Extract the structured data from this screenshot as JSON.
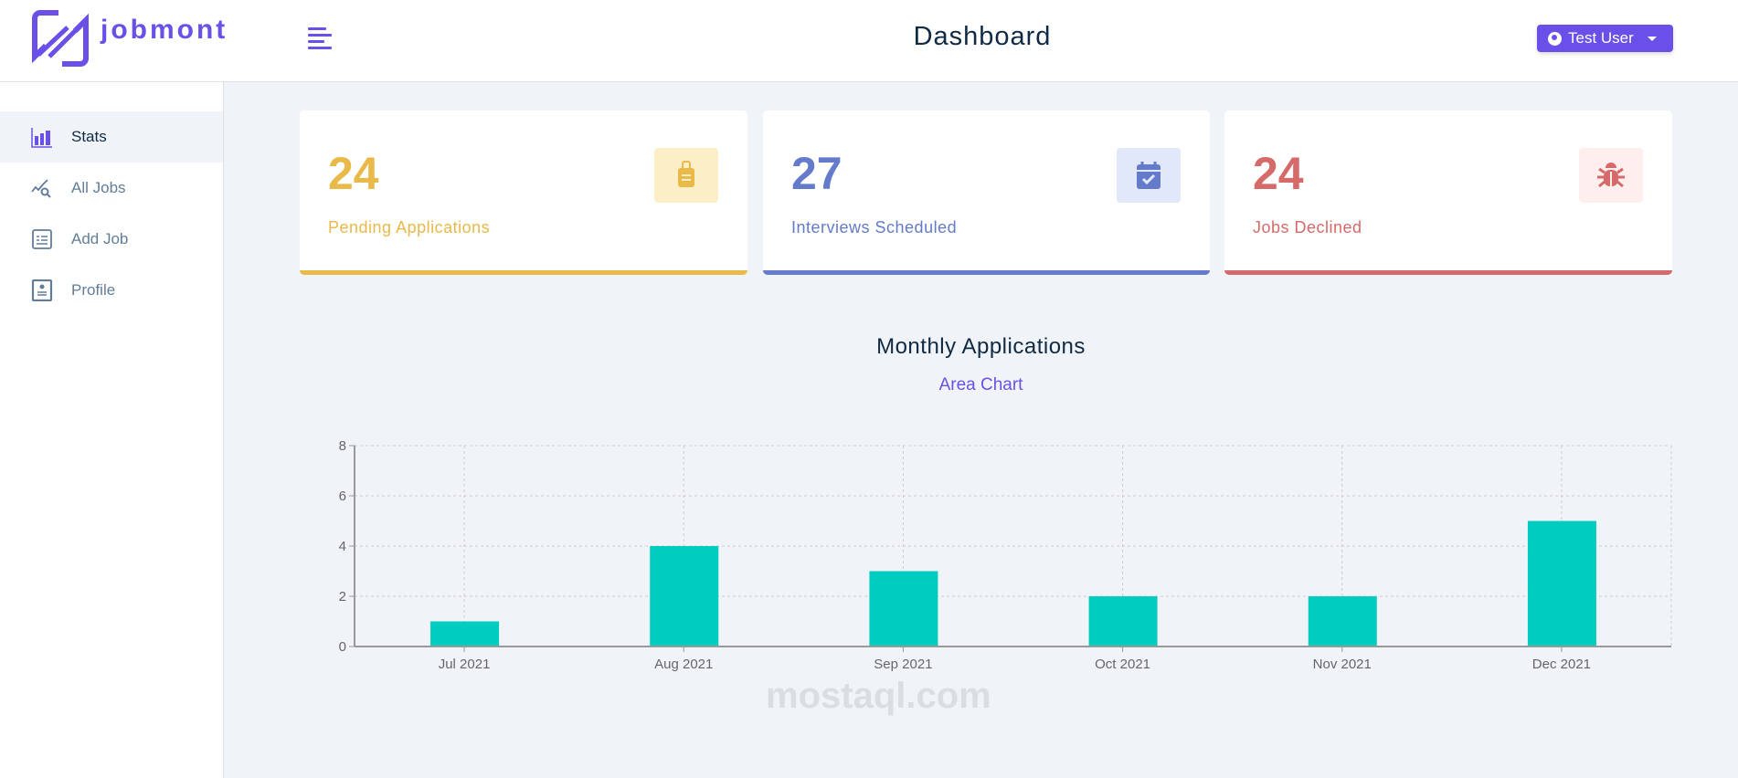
{
  "header": {
    "brand": "jobmont",
    "title": "Dashboard",
    "user": "Test User"
  },
  "sidebar": {
    "items": [
      {
        "label": "Stats",
        "icon": "bar-chart-icon"
      },
      {
        "label": "All Jobs",
        "icon": "chart-search-icon"
      },
      {
        "label": "Add Job",
        "icon": "form-icon"
      },
      {
        "label": "Profile",
        "icon": "profile-icon"
      }
    ]
  },
  "stats": [
    {
      "value": "24",
      "label": "Pending Applications",
      "color": "#e9b949",
      "bg": "#fcefc7",
      "icon": "suitcase-icon"
    },
    {
      "value": "27",
      "label": "Interviews Scheduled",
      "color": "#647acb",
      "bg": "#e0e8f9",
      "icon": "calendar-check-icon"
    },
    {
      "value": "24",
      "label": "Jobs Declined",
      "color": "#d66a6a",
      "bg": "#ffeeee",
      "icon": "bug-icon"
    }
  ],
  "chart_section": {
    "title": "Monthly Applications",
    "toggle": "Area Chart"
  },
  "chart_data": {
    "type": "bar",
    "categories": [
      "Jul 2021",
      "Aug 2021",
      "Sep 2021",
      "Oct 2021",
      "Nov 2021",
      "Dec 2021"
    ],
    "values": [
      1,
      4,
      3,
      2,
      2,
      5
    ],
    "ylim": [
      0,
      8
    ],
    "yticks": [
      0,
      2,
      4,
      6,
      8
    ],
    "grid": true,
    "bar_color": "#00ccc0"
  },
  "watermark": "mostaql.com"
}
